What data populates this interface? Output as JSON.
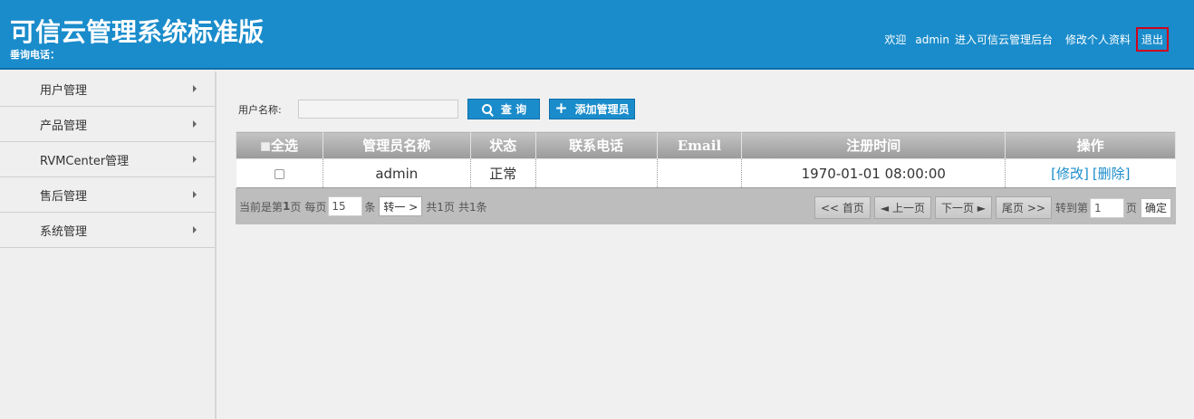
{
  "header": {
    "title": "可信云管理系统标准版",
    "hotline": "垂询电话：",
    "welcome": "欢迎",
    "username": "admin",
    "enter_admin": "进入可信云管理后台",
    "edit_profile": "修改个人资料",
    "logout": "退出"
  },
  "sidebar": {
    "items": [
      {
        "label": "用户管理"
      },
      {
        "label": "产品管理"
      },
      {
        "label": "RVMCenter管理"
      },
      {
        "label": "售后管理"
      },
      {
        "label": "系统管理"
      }
    ]
  },
  "search": {
    "label": "用户名称:",
    "value": "",
    "query_button": "查 询",
    "add_button": "添加管理员"
  },
  "table": {
    "headers": {
      "select_all": "全选",
      "name": "管理员名称",
      "status": "状态",
      "phone": "联系电话",
      "email": "Email",
      "reg_time": "注册时间",
      "actions": "操作"
    },
    "rows": [
      {
        "name": "admin",
        "status": "正常",
        "phone": "",
        "email": "",
        "reg_time": "1970-01-01 08:00:00",
        "edit": "[修改]",
        "delete": "[删除]"
      }
    ]
  },
  "pager": {
    "current_prefix": "当前是第",
    "current_page": "1",
    "page_suffix": "页",
    "per_page_label": "每页",
    "per_page_value": "15",
    "per_page_unit": "条",
    "goto_button": "转一 >",
    "total_pages": "共1页",
    "total_items": "共1条",
    "first": "<< 首页",
    "prev": "◄ 上一页",
    "next": "下一页 ►",
    "last": "尾页 >>",
    "jump_label": "转到第",
    "jump_value": "1",
    "jump_unit": "页",
    "confirm": "确定"
  }
}
